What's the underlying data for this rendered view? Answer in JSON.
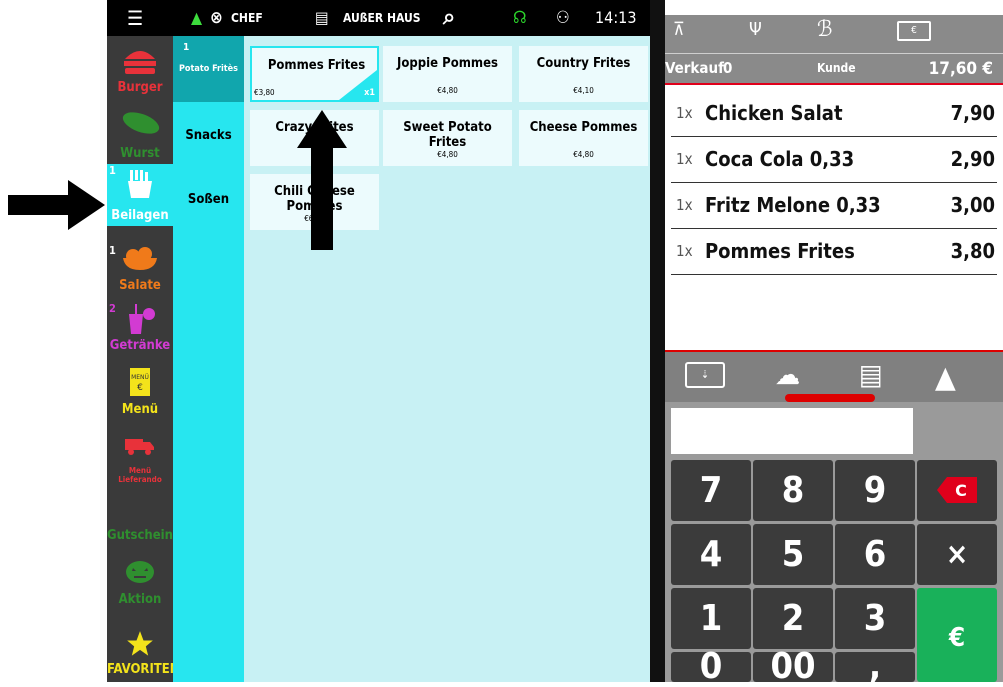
{
  "topbar": {
    "user_label": "CHEF",
    "mode_label": "AUßER HAUS",
    "time": "14:13"
  },
  "categories": [
    {
      "label": "Burger",
      "color": "#e8323a",
      "count": ""
    },
    {
      "label": "Wurst",
      "color": "#2f8f2f",
      "count": ""
    },
    {
      "label": "Beilagen",
      "color": "#ffffff",
      "count": "1"
    },
    {
      "label": "Salate",
      "color": "#f07a1a",
      "count": "1"
    },
    {
      "label": "Getränke",
      "color": "#d23bd2",
      "count": "2"
    },
    {
      "label": "Menü",
      "color": "#f3e31b",
      "count": ""
    },
    {
      "label": "Menü Lieferando",
      "color": "#e8323a",
      "count": ""
    },
    {
      "label": "Gutschein",
      "color": "#2f8f2f",
      "count": ""
    },
    {
      "label": "Aktion",
      "color": "#2f8f2f",
      "count": ""
    },
    {
      "label": "FAVORITEN",
      "color": "#f3e31b",
      "count": ""
    }
  ],
  "subcategories": [
    {
      "label": "Potato Fritès",
      "count": "1"
    },
    {
      "label": "Snacks"
    },
    {
      "label": "Soßen"
    }
  ],
  "products": [
    {
      "name": "Pommes Frites",
      "price": "€3,80",
      "qty": "x1"
    },
    {
      "name": "Joppie Pommes",
      "price": "€4,80"
    },
    {
      "name": "Country Frites",
      "price": "€4,10"
    },
    {
      "name": "Crazy Frites",
      "price": "€"
    },
    {
      "name": "Sweet Potato Frites",
      "price": "€4,80"
    },
    {
      "name": "Cheese Pommes",
      "price": "€4,80"
    },
    {
      "name": "Chili Cheese Pommes",
      "price": "€6,10"
    }
  ],
  "order_header": {
    "sale_label": "Verkauf",
    "sale_value": "0",
    "customer_label": "Kunde",
    "total": "17,60 €"
  },
  "order_items": [
    {
      "qty": "1x",
      "name": "Chicken Salat",
      "price": "7,90"
    },
    {
      "qty": "1x",
      "name": "Coca Cola 0,33",
      "price": "2,90"
    },
    {
      "qty": "1x",
      "name": "Fritz Melone 0,33",
      "price": "3,00"
    },
    {
      "qty": "1x",
      "name": "Pommes Frites",
      "price": "3,80"
    }
  ],
  "keypad": {
    "keys": [
      "7",
      "8",
      "9",
      "4",
      "5",
      "6",
      "1",
      "2",
      "3",
      "0",
      "00",
      ","
    ],
    "clear": "C",
    "multiply": "×"
  },
  "colors": {
    "accent_cyan": "#27e6ef",
    "sidebar_bg": "#3a3a3a",
    "red_accent": "#e0001b",
    "pay_green": "#19b15a"
  }
}
